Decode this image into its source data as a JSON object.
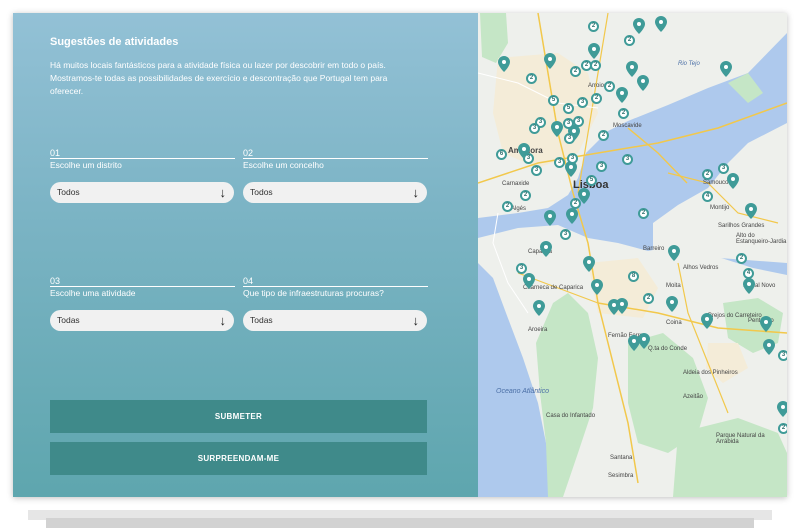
{
  "form": {
    "title": "Sugestões de atividades",
    "description": "Há muitos locais fantásticos para a atividade física ou lazer por descobrir em todo o país. Mostramos-te todas as possibilidades de exercício e descontração que Portugal tem para oferecer.",
    "steps": [
      {
        "number": "01",
        "label": "Escolhe um distrito",
        "value": "Todos"
      },
      {
        "number": "02",
        "label": "Escolhe um concelho",
        "value": "Todos"
      },
      {
        "number": "03",
        "label": "Escolhe uma atividade",
        "value": "Todas"
      },
      {
        "number": "04",
        "label": "Que tipo de infraestruturas procuras?",
        "value": "Todas"
      }
    ],
    "submit_label": "SUBMETER",
    "surprise_label": "SURPREENDAM-ME"
  },
  "map": {
    "places": {
      "lisboa": "Lisboa",
      "amadora": "Amadora",
      "carnaxide": "Carnaxide",
      "alges": "Algés",
      "caparica": "Caparica",
      "charneca": "Charneca de Caparica",
      "barreiro": "Barreiro",
      "montijo": "Montijo",
      "coina": "Coina",
      "alhos_vedros": "Alhos Vedros",
      "quinta_conde": "Q.ta do Conde",
      "oceano": "Oceano Atlântico",
      "santana": "Santana",
      "sesimbra": "Sesimbra",
      "azeitao": "Azeitão",
      "aroeira": "Aroeira",
      "fernao_ferro": "Fernão Ferro",
      "pinheiros": "Aldeia dos Pinheiros",
      "moscavide": "Moscavide",
      "rio_tejo": "Rio Tejo",
      "sarilhos": "Sarilhos Grandes",
      "alto_estanqueiro": "Alto do Estanqueiro-Jardia",
      "pinhal_novo": "Pinhal Novo",
      "parque_arrabida": "Parque Natural da Arrábida",
      "casa_infantado": "Casa do Infantado",
      "penteado": "Penteado",
      "brejos": "Brejos do Carreteiro",
      "moita": "Moita",
      "arroios": "Arroios",
      "samouco": "Samouco"
    },
    "pin_color": "#3f9b98",
    "clusters": [
      "2",
      "2",
      "2",
      "2",
      "3",
      "3",
      "2",
      "2",
      "5",
      "5",
      "2",
      "2",
      "3",
      "3",
      "2",
      "2",
      "3",
      "3",
      "5",
      "3",
      "3",
      "3",
      "3",
      "3",
      "6",
      "3",
      "2",
      "2",
      "2",
      "4",
      "2",
      "3",
      "8",
      "2",
      "3",
      "3",
      "2",
      "2",
      "4",
      "3",
      "2"
    ]
  },
  "colors": {
    "button": "#3f8a8a",
    "panel_top": "#93c1d6",
    "panel_bottom": "#5ea6ae",
    "water": "#aec9ed",
    "land": "#eef0ec",
    "park": "#c5e6c6"
  }
}
